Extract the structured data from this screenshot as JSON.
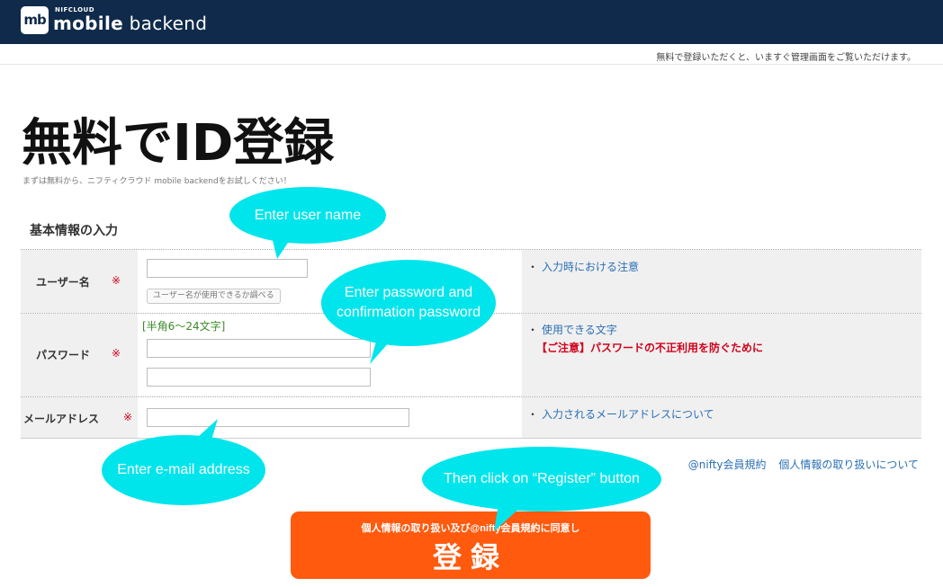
{
  "header": {
    "brand_small": "NIFCLOUD",
    "logo_mark": "mb",
    "brand_main_bold": "mobile",
    "brand_main_light": " backend",
    "colors": {
      "bar": "#0f2a4a"
    }
  },
  "notice": "無料で登録いただくと、いますぐ管理画面をご覧いただけます。",
  "page": {
    "title": "無料でID登録",
    "subtitle": "まずは無料から、ニフティクラウド mobile backendをお試しください！"
  },
  "section_title": "基本情報の入力",
  "form": {
    "username": {
      "label": "ユーザー名",
      "required_mark": "※",
      "value": "",
      "check_button": "ユーザー名が使用できるか調べる",
      "note_link": "入力時における注意"
    },
    "password": {
      "label": "パスワード",
      "required_mark": "※",
      "hint": "[半角6〜24文字]",
      "value": "",
      "confirm_value": "",
      "note_link": "使用できる文字",
      "warning": "【ご注意】パスワードの不正利用を防ぐために"
    },
    "email": {
      "label": "メールアドレス",
      "required_mark": "※",
      "value": "",
      "note_link": "入力されるメールアドレスについて"
    },
    "note_bullet": "・"
  },
  "links": {
    "terms": "@nifty会員規約",
    "privacy": "個人情報の取り扱いについて"
  },
  "register": {
    "small_label": "個人情報の取り扱い及び@nifty会員規約に同意し",
    "big_label": "登録",
    "color": "#ff5a0e"
  },
  "callouts": {
    "username": "Enter user name",
    "password_line1": "Enter password and",
    "password_line2": "confirmation password",
    "email": "Enter e-mail address",
    "register": "Then click on “Register” button",
    "color": "#00e5ec"
  }
}
